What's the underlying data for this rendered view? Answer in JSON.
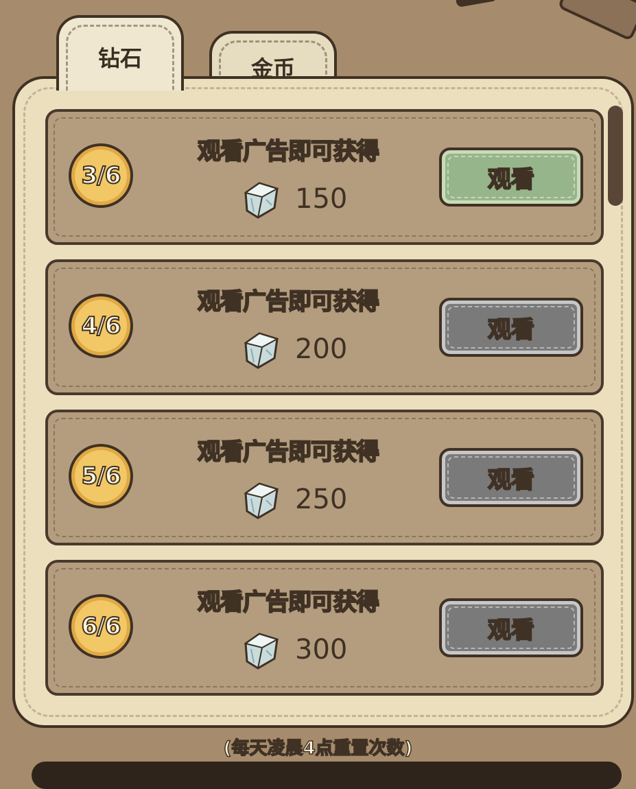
{
  "tabs": [
    {
      "label": "钻石",
      "active": true
    },
    {
      "label": "金币",
      "active": false
    }
  ],
  "rows": [
    {
      "progress": "3/6",
      "title": "观看广告即可获得",
      "reward_icon": "diamond-icon",
      "amount": "150",
      "button_label": "观看",
      "button_state": "active-green"
    },
    {
      "progress": "4/6",
      "title": "观看广告即可获得",
      "reward_icon": "diamond-icon",
      "amount": "200",
      "button_label": "观看",
      "button_state": "disabled-gray"
    },
    {
      "progress": "5/6",
      "title": "观看广告即可获得",
      "reward_icon": "diamond-icon",
      "amount": "250",
      "button_label": "观看",
      "button_state": "disabled-gray"
    },
    {
      "progress": "6/6",
      "title": "观看广告即可获得",
      "reward_icon": "diamond-icon",
      "amount": "300",
      "button_label": "观看",
      "button_state": "disabled-gray"
    }
  ],
  "footer_note": "(每天凌晨4点重置次数)",
  "colors": {
    "background": "#a68c6c",
    "panel": "#ebdfbe",
    "row": "#b49d7e",
    "button_green": "#97b58a",
    "button_gray": "#7a7a7a",
    "badge_gold": "#f2c866",
    "outline": "#3f3124"
  }
}
